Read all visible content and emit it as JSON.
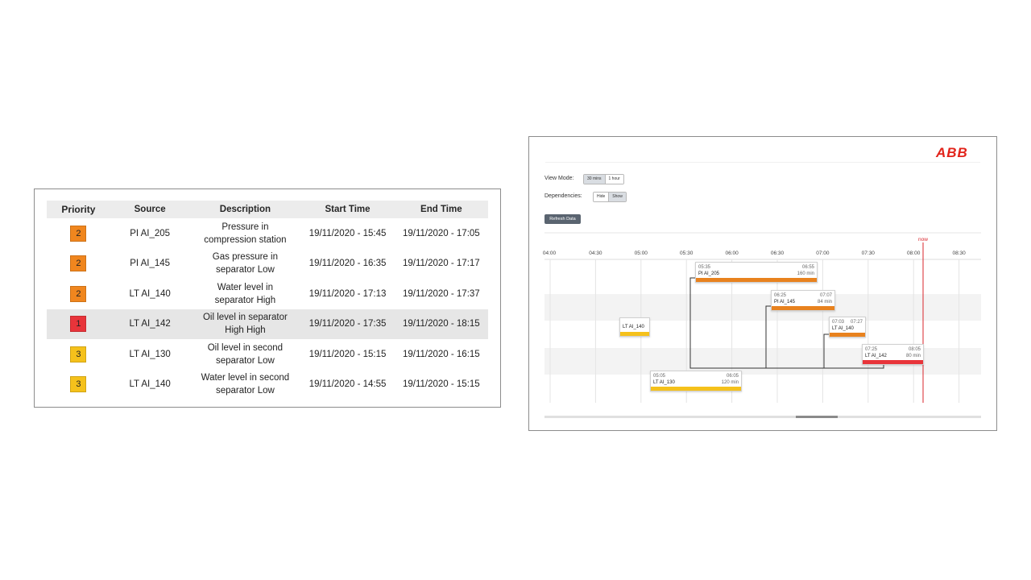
{
  "alarm_table": {
    "columns": [
      "Priority",
      "Source",
      "Description",
      "Start Time",
      "End Time"
    ],
    "rows": [
      {
        "priority": "2",
        "priority_color": "#f0861e",
        "source": "PI AI_205",
        "desc1": "Pressure in",
        "desc2": "compression station",
        "start": "19/11/2020 - 15:45",
        "end": "19/11/2020 - 17:05"
      },
      {
        "priority": "2",
        "priority_color": "#f0861e",
        "source": "PI AI_145",
        "desc1": "Gas pressure in",
        "desc2": "separator Low",
        "start": "19/11/2020 - 16:35",
        "end": "19/11/2020 - 17:17"
      },
      {
        "priority": "2",
        "priority_color": "#f0861e",
        "source": "LT AI_140",
        "desc1": "Water level in",
        "desc2": "separator High",
        "start": "19/11/2020 - 17:13",
        "end": "19/11/2020 - 17:37"
      },
      {
        "priority": "1",
        "priority_color": "#e8343a",
        "source": "LT AI_142",
        "desc1": "Oil level in separator",
        "desc2": "High High",
        "start": "19/11/2020 - 17:35",
        "end": "19/11/2020 - 18:15"
      },
      {
        "priority": "3",
        "priority_color": "#f5c11b",
        "source": "LT AI_130",
        "desc1": "Oil level in second",
        "desc2": "separator Low",
        "start": "19/11/2020 - 15:15",
        "end": "19/11/2020 - 16:15"
      },
      {
        "priority": "3",
        "priority_color": "#f5c11b",
        "source": "LT AI_140",
        "desc1": "Water level in second",
        "desc2": "separator Low",
        "start": "19/11/2020 - 14:55",
        "end": "19/11/2020 - 15:15"
      }
    ]
  },
  "gantt": {
    "logo": "ABB",
    "view_mode_label": "View Mode:",
    "view_mode_options": [
      "30 mins",
      "1 hour"
    ],
    "dependencies_label": "Dependencies:",
    "dependencies_options": [
      "Hide",
      "Show"
    ],
    "refresh_label": "Refresh Data",
    "now_label": "now",
    "now_color": "#d9242b",
    "time_ticks": [
      "04:00",
      "04:30",
      "05:00",
      "05:30",
      "06:00",
      "06:30",
      "07:00",
      "07:30",
      "08:00",
      "08:30"
    ],
    "tasks": [
      {
        "name": "PI AI_205",
        "start": "05:35",
        "end": "06:55",
        "duration": "160 min",
        "color": "#e8821e"
      },
      {
        "name": "PI AI_145",
        "start": "06:25",
        "end": "07:07",
        "duration": "84 min",
        "color": "#e8821e"
      },
      {
        "name": "LT AI_140",
        "start": "",
        "end": "",
        "duration": "",
        "color": "#f5c11b"
      },
      {
        "name": "LT AI_140",
        "start": "07:03",
        "end": "07:27",
        "duration": "",
        "color": "#e8821e"
      },
      {
        "name": "LT AI_142",
        "start": "07:25",
        "end": "08:05",
        "duration": "80 min",
        "color": "#e8343a"
      },
      {
        "name": "LT AI_130",
        "start": "05:05",
        "end": "06:05",
        "duration": "120 min",
        "color": "#f5c11b"
      }
    ]
  }
}
